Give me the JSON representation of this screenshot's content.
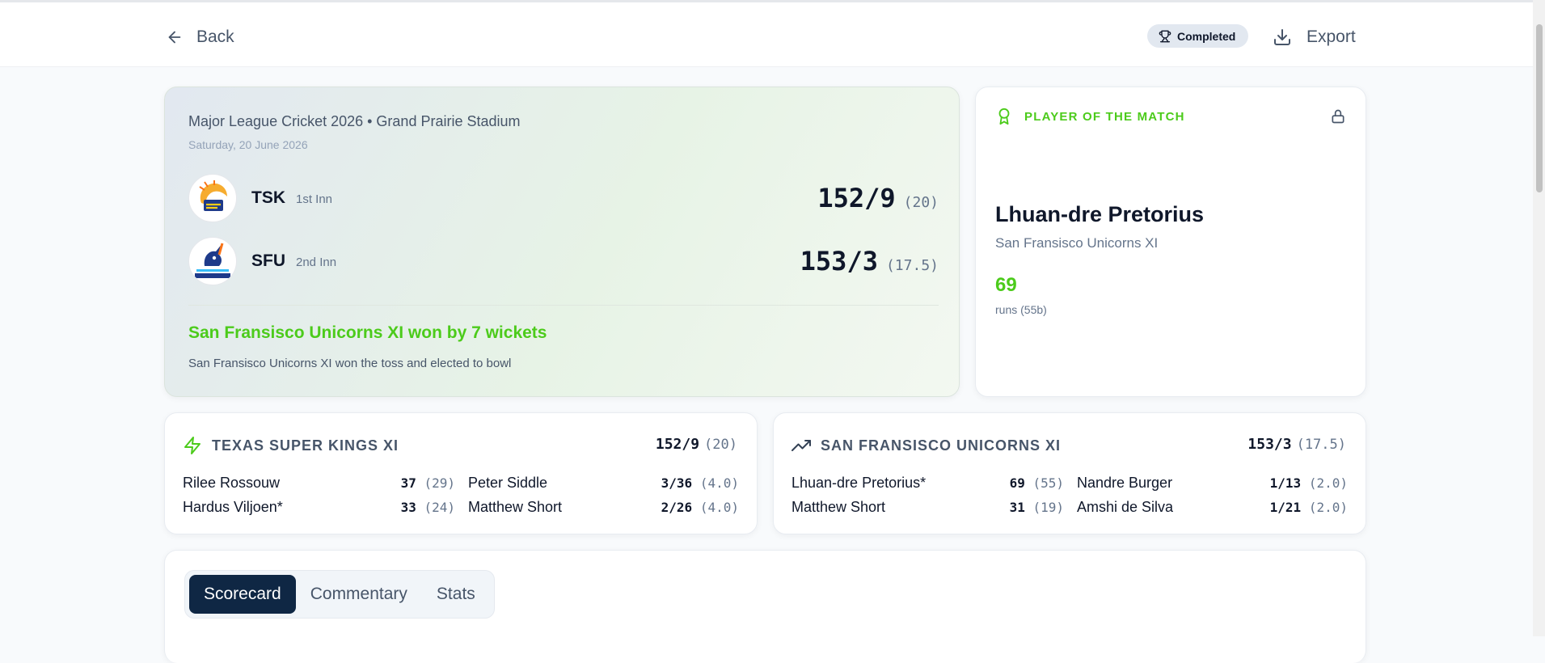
{
  "header": {
    "back_label": "Back",
    "status_badge": "Completed",
    "export_label": "Export"
  },
  "match": {
    "title": "Major League Cricket 2026 • Grand Prairie Stadium",
    "date": "Saturday, 20 June 2026",
    "teams": [
      {
        "code": "TSK",
        "innings": "1st Inn",
        "score": "152/9",
        "overs": "(20)"
      },
      {
        "code": "SFU",
        "innings": "2nd Inn",
        "score": "153/3",
        "overs": "(17.5)"
      }
    ],
    "result": "San Fransisco Unicorns XI won by 7 wickets",
    "toss": "San Fransisco Unicorns XI won the toss and elected to bowl"
  },
  "player_of_match": {
    "heading": "PLAYER OF THE MATCH",
    "name": "Lhuan-dre Pretorius",
    "team": "San Fransisco Unicorns XI",
    "runs": "69",
    "balls": "runs (55b)"
  },
  "innings_cards": [
    {
      "team": "TEXAS SUPER KINGS XI",
      "score": "152/9",
      "overs": "(20)",
      "batters": [
        {
          "name": "Rilee Rossouw",
          "stat": "37",
          "detail": "(29)"
        },
        {
          "name": "Hardus Viljoen*",
          "stat": "33",
          "detail": "(24)"
        }
      ],
      "bowlers": [
        {
          "name": "Peter Siddle",
          "stat": "3/36",
          "detail": "(4.0)"
        },
        {
          "name": "Matthew Short",
          "stat": "2/26",
          "detail": "(4.0)"
        }
      ]
    },
    {
      "team": "SAN FRANSISCO UNICORNS XI",
      "score": "153/3",
      "overs": "(17.5)",
      "batters": [
        {
          "name": "Lhuan-dre Pretorius*",
          "stat": "69",
          "detail": "(55)"
        },
        {
          "name": "Matthew Short",
          "stat": "31",
          "detail": "(19)"
        }
      ],
      "bowlers": [
        {
          "name": "Nandre Burger",
          "stat": "1/13",
          "detail": "(2.0)"
        },
        {
          "name": "Amshi de Silva",
          "stat": "1/21",
          "detail": "(2.0)"
        }
      ]
    }
  ],
  "tabs": [
    {
      "label": "Scorecard",
      "active": true
    },
    {
      "label": "Commentary",
      "active": false
    },
    {
      "label": "Stats",
      "active": false
    }
  ],
  "colors": {
    "accent_green": "#4ccb1b",
    "active_tab": "#0f2744",
    "text_dark": "#0f172a",
    "text_muted": "#64748b"
  },
  "icons": {
    "back": "arrow-left-icon",
    "badge": "trophy-icon",
    "export": "download-icon",
    "potm": "award-icon",
    "lock": "lock-icon",
    "innings1": "lightning-icon",
    "innings2": "trending-up-icon"
  }
}
